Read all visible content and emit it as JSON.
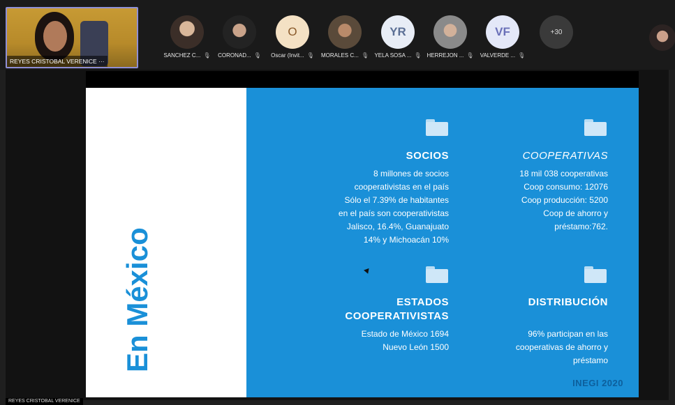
{
  "self_tile": {
    "name": "REYES CRISTOBAL VERENICE",
    "more": "···"
  },
  "participants": [
    {
      "label": "SANCHEZ C..."
    },
    {
      "label": "CORONAD..."
    },
    {
      "label": "Oscar (Invit...",
      "initials": "O"
    },
    {
      "label": "MORALES C..."
    },
    {
      "label": "YELA SOSA ...",
      "initials": "YR"
    },
    {
      "label": "HERREJON ..."
    },
    {
      "label": "VALVERDE ...",
      "initials": "VF"
    }
  ],
  "more_participants": "+30",
  "mic_glyph": "🎙",
  "slide": {
    "title": "En México",
    "socios": {
      "heading": "SOCIOS",
      "lines": [
        "8 millones de socios",
        "cooperativistas en el país",
        "Sólo el 7.39% de habitantes",
        "en el país son cooperativistas",
        "Jalisco, 16.4%, Guanajuato",
        "14% y Michoacán 10%"
      ]
    },
    "cooperativas": {
      "heading": "COOPERATIVAS",
      "lines": [
        "18 mil 038 cooperativas",
        "Coop consumo: 12076",
        "Coop producción: 5200",
        "Coop de ahorro y",
        "préstamo:762."
      ]
    },
    "estados": {
      "heading_1": "ESTADOS",
      "heading_2": "COOPERATIVISTAS",
      "lines": [
        "Estado de México 1694",
        "Nuevo León 1500"
      ]
    },
    "distribucion": {
      "heading": "DISTRIBUCIÓN",
      "lines": [
        "96% participan en las",
        "cooperativas de ahorro y",
        "préstamo"
      ]
    },
    "source": "INEGI 2020",
    "colors": {
      "accent": "#1a90d8",
      "source": "#0d5f9c"
    }
  },
  "presenter_name": "REYES CRISTOBAL VERENICE"
}
